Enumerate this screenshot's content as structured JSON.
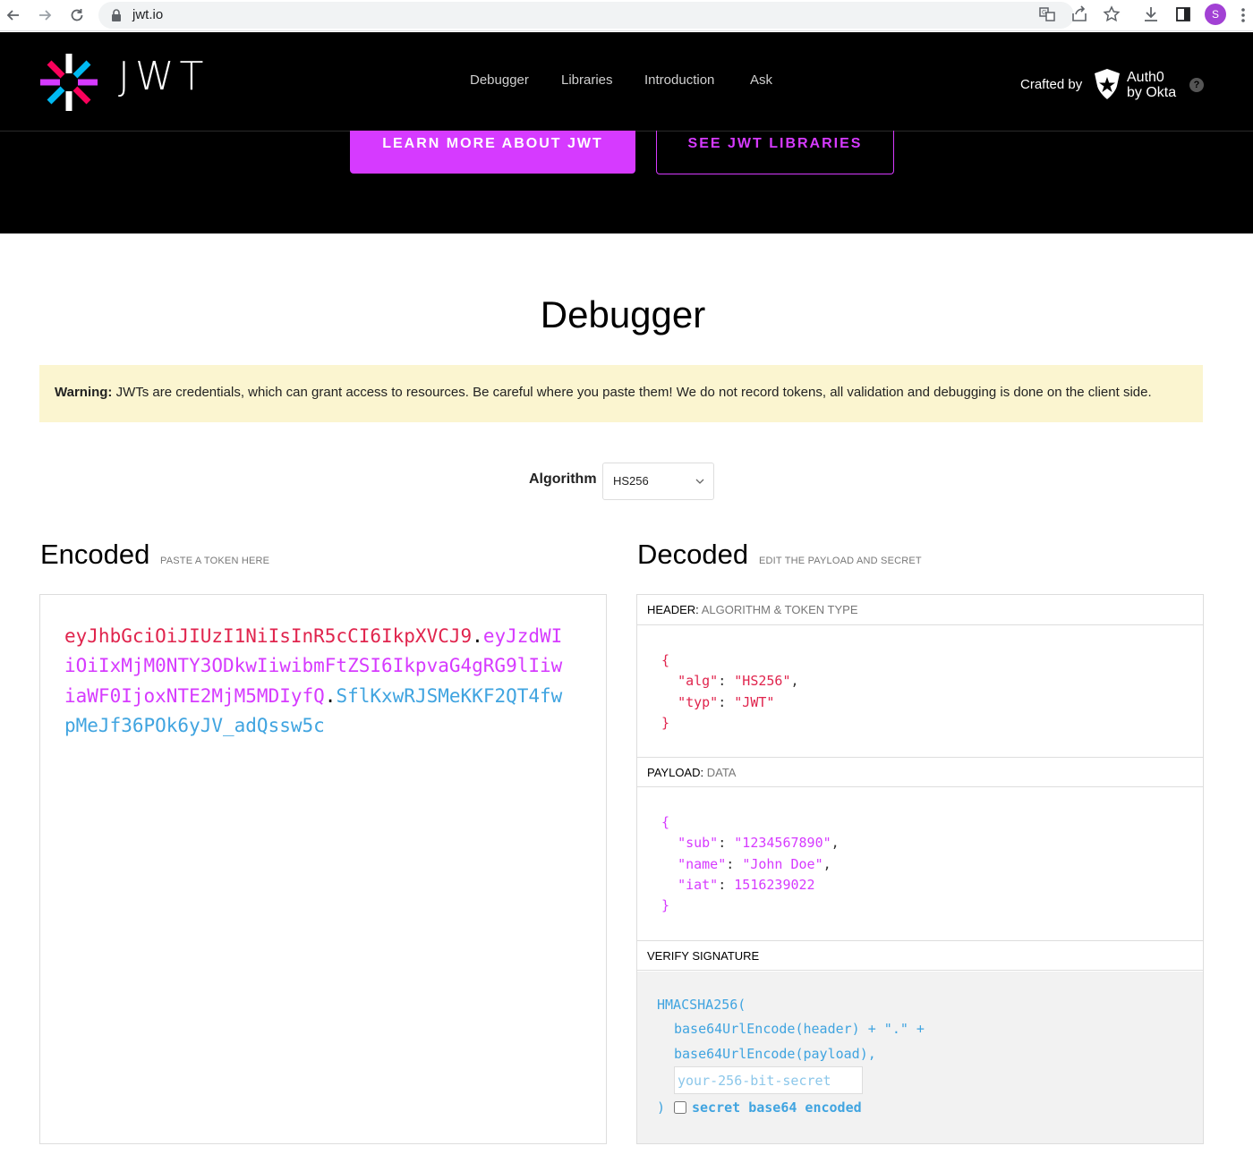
{
  "browser": {
    "url": "jwt.io",
    "profile_initial": "S"
  },
  "site": {
    "logo_text": "JWT",
    "nav": [
      "Debugger",
      "Libraries",
      "Introduction",
      "Ask"
    ],
    "crafted_by": "Crafted by",
    "auth0_line1": "Auth0",
    "auth0_line2": "by Okta",
    "help": "?"
  },
  "hero": {
    "learn_more": "LEARN MORE ABOUT JWT",
    "see_libraries": "SEE JWT LIBRARIES"
  },
  "debugger": {
    "title": "Debugger",
    "warning_label": "Warning:",
    "warning_text": " JWTs are credentials, which can grant access to resources. Be careful where you paste them! We do not record tokens, all validation and debugging is done on the client side.",
    "algorithm_label": "Algorithm",
    "algorithm_value": "HS256"
  },
  "encoded": {
    "title": "Encoded",
    "subtitle": "PASTE A TOKEN HERE",
    "token_header": "eyJhbGciOiJIUzI1NiIsInR5cCI6IkpXVCJ9",
    "token_payload": "eyJzdWIiOiIxMjM0NTY3ODkwIiwibmFtZSI6IkpvaG4gRG9lIiwiaWF0IjoxNTE2MjM5MDIyfQ",
    "token_signature": "SflKxwRJSMeKKF2QT4fwpMeJf36POk6yJV_adQssw5c",
    "dot": "."
  },
  "decoded": {
    "title": "Decoded",
    "subtitle": "EDIT THE PAYLOAD AND SECRET",
    "header_section": {
      "label": "HEADER:",
      "label_muted": " ALGORITHM & TOKEN TYPE",
      "open": "{",
      "close": "}",
      "alg_key": "\"alg\"",
      "alg_val": "\"HS256\"",
      "typ_key": "\"typ\"",
      "typ_val": "\"JWT\""
    },
    "payload_section": {
      "label": "PAYLOAD:",
      "label_muted": " DATA",
      "open": "{",
      "close": "}",
      "sub_key": "\"sub\"",
      "sub_val": "\"1234567890\"",
      "name_key": "\"name\"",
      "name_val": "\"John Doe\"",
      "iat_key": "\"iat\"",
      "iat_val": "1516239022"
    },
    "verify_section": {
      "label": "VERIFY SIGNATURE",
      "fn": "HMACSHA256(",
      "line1": "base64UrlEncode(header) + \".\" +",
      "line2": "base64UrlEncode(payload),",
      "secret_placeholder": "your-256-bit-secret",
      "close_paren": ")",
      "b64_label": "secret base64 encoded"
    }
  },
  "colors": {
    "accent": "#d63aff",
    "header_red": "#e0244d",
    "signature_blue": "#40a4e0",
    "warning_bg": "#fbf5d0"
  }
}
